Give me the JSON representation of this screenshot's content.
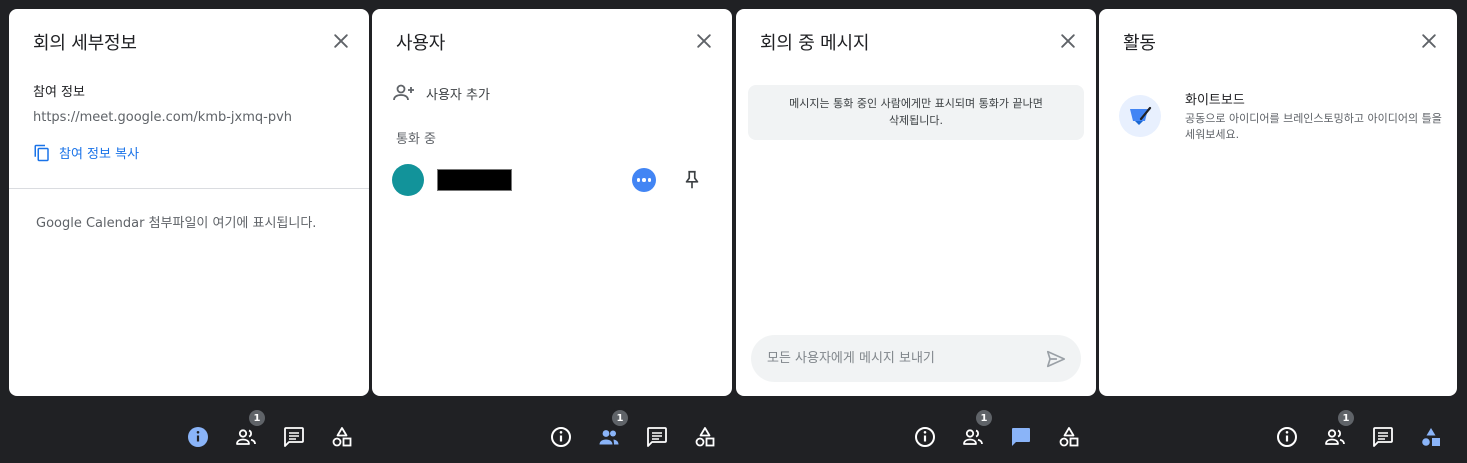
{
  "details": {
    "title": "회의 세부정보",
    "join_info_label": "참여 정보",
    "url": "https://meet.google.com/kmb-jxmq-pvh",
    "copy_label": "참여 정보 복사",
    "calendar_note": "Google Calendar 첨부파일이 여기에 표시됩니다."
  },
  "people": {
    "title": "사용자",
    "add_label": "사용자 추가",
    "section_label": "통화 중"
  },
  "chat": {
    "title": "회의 중 메시지",
    "notice_line1": "메시지는 통화 중인 사람에게만 표시되며 통화가 끝나면",
    "notice_line2": "삭제됩니다.",
    "input_placeholder": "모든 사용자에게 메시지 보내기"
  },
  "activities": {
    "title": "활동",
    "whiteboard_title": "화이트보드",
    "whiteboard_desc": "공동으로 아이디어를 브레인스토밍하고 아이디어의 틀을 세워보세요."
  },
  "bottom_bar": {
    "people_count": "1",
    "active_color": "#8ab4f8",
    "icon_color": "#ffffff"
  },
  "colors": {
    "avatar": "#12939a",
    "link": "#1a73e8",
    "more_button": "#4285f4"
  }
}
